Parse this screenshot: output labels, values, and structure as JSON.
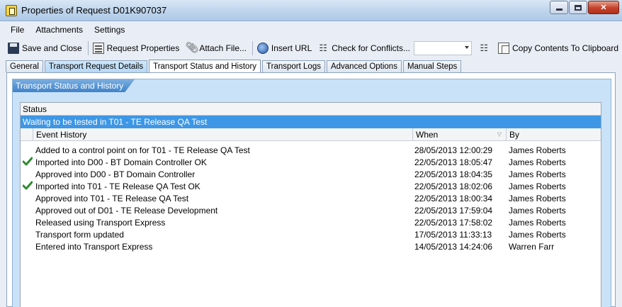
{
  "window": {
    "title": "Properties of Request D01K907037"
  },
  "menu": [
    "File",
    "Attachments",
    "Settings"
  ],
  "toolbar": {
    "save_close": "Save and Close",
    "request_properties": "Request Properties",
    "attach_file": "Attach File...",
    "insert_url": "Insert URL",
    "check_conflicts": "Check for Conflicts...",
    "conflict_select_value": "",
    "copy_clipboard": "Copy Contents To Clipboard"
  },
  "tabs": [
    {
      "label": "General"
    },
    {
      "label": "Transport Request Details"
    },
    {
      "label": "Transport Status and History"
    },
    {
      "label": "Transport Logs"
    },
    {
      "label": "Advanced Options"
    },
    {
      "label": "Manual Steps"
    }
  ],
  "section_title": "Transport Status and History",
  "grid": {
    "status_header": "Status",
    "status_value": "Waiting to be tested in T01 - TE Release QA Test",
    "columns": {
      "event": "Event History",
      "when": "When",
      "by": "By"
    },
    "rows": [
      {
        "ok": false,
        "event": "Added to a control point on for T01 - TE Release QA Test",
        "when": "28/05/2013 12:00:29",
        "by": "James Roberts"
      },
      {
        "ok": true,
        "event": "Imported into D00 - BT Domain Controller OK",
        "when": "22/05/2013 18:05:47",
        "by": "James Roberts"
      },
      {
        "ok": false,
        "event": "Approved into D00 - BT Domain Controller",
        "when": "22/05/2013 18:04:35",
        "by": "James Roberts"
      },
      {
        "ok": true,
        "event": "Imported into T01 - TE Release QA Test OK",
        "when": "22/05/2013 18:02:06",
        "by": "James Roberts"
      },
      {
        "ok": false,
        "event": "Approved into T01 - TE Release QA Test",
        "when": "22/05/2013 18:00:34",
        "by": "James Roberts"
      },
      {
        "ok": false,
        "event": "Approved out of D01 - TE Release Development",
        "when": "22/05/2013 17:59:04",
        "by": "James Roberts"
      },
      {
        "ok": false,
        "event": "Released using Transport Express",
        "when": "22/05/2013 17:58:02",
        "by": "James Roberts"
      },
      {
        "ok": false,
        "event": "Transport form updated",
        "when": "17/05/2013 11:33:13",
        "by": "James Roberts"
      },
      {
        "ok": false,
        "event": "Entered into Transport Express",
        "when": "14/05/2013 14:24:06",
        "by": "Warren Farr"
      }
    ]
  },
  "colors": {
    "status_highlight": "#3d97e6",
    "section_bg": "#c9e2f7",
    "check_green": "#2e8b2e"
  }
}
